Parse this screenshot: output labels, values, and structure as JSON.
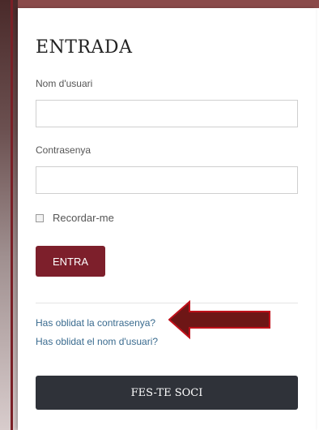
{
  "login": {
    "title": "ENTRADA",
    "username_label": "Nom d'usuari",
    "username_value": "",
    "password_label": "Contrasenya",
    "password_value": "",
    "remember_label": "Recordar-me",
    "remember_checked": false,
    "submit_label": "ENTRA",
    "forgot_password_link": "Has oblidat la contrasenya?",
    "forgot_username_link": "Has oblidat el nom d'usuari?",
    "join_label": "FES-TE SOCI"
  },
  "colors": {
    "accent": "#7d1f2b",
    "join_button": "#2f3239",
    "link": "#3a6b8f",
    "arrow": "#8b1a1a"
  },
  "icons": {
    "annotation": "arrow-left-icon"
  }
}
